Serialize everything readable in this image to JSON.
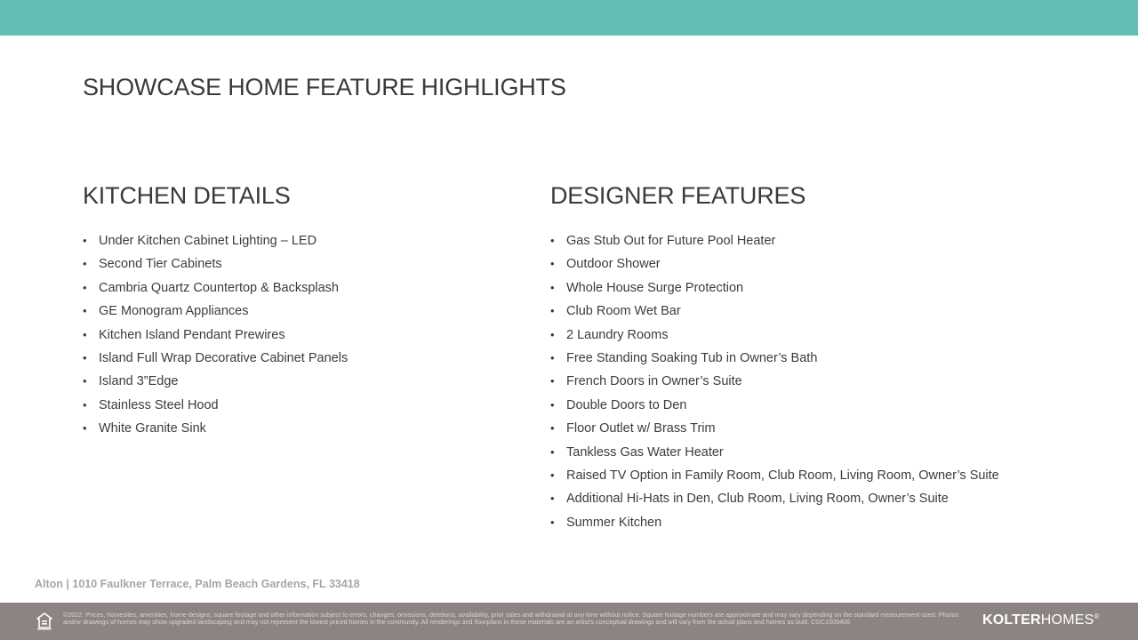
{
  "colors": {
    "top_band": "#63bdb2",
    "footer_band": "#8c8480",
    "text": "#404040"
  },
  "title": "SHOWCASE HOME FEATURE HIGHLIGHTS",
  "kitchen": {
    "heading": "KITCHEN DETAILS",
    "items": [
      "Under Kitchen Cabinet Lighting – LED",
      "Second Tier Cabinets",
      "Cambria Quartz Countertop & Backsplash",
      "GE Monogram Appliances",
      "Kitchen Island Pendant Prewires",
      "Island Full Wrap Decorative Cabinet Panels",
      "Island 3”Edge",
      "Stainless Steel Hood",
      "White Granite Sink"
    ]
  },
  "designer": {
    "heading": "DESIGNER FEATURES",
    "items": [
      "Gas Stub Out for Future Pool Heater",
      "Outdoor Shower",
      "Whole House Surge Protection",
      "Club Room Wet Bar",
      "2 Laundry Rooms",
      "Free Standing Soaking Tub in Owner’s Bath",
      "French Doors in Owner’s Suite",
      "Double Doors to Den",
      "Floor Outlet w/ Brass Trim",
      "Tankless Gas Water Heater",
      "Raised TV Option in Family Room, Club Room, Living Room, Owner’s Suite",
      "Additional Hi-Hats in Den, Club Room, Living Room, Owner’s Suite",
      "Summer Kitchen"
    ]
  },
  "bullet": "•",
  "address": "Alton | 1010 Faulkner Terrace, Palm Beach Gardens, FL 33418",
  "footer": {
    "disclaimer": "©2022. Prices, homesites, amenities, home designs, square footage and other information subject to errors, changes, omissions, deletions, availability, prior sales and withdrawal at any time without notice. Square footage numbers are approximate and may vary depending on the standard measurement used. Photos and/or drawings of homes may show upgraded landscaping and may not represent the lowest priced homes in the community. All renderings and floorplans in these materials are an artist’s conceptual drawings and will vary from the actual plans and homes as built. CGC1509406",
    "logo_bold": "KOLTER",
    "logo_light": "HOMES",
    "logo_mark": "®",
    "eho_icon": "equal-housing-icon"
  }
}
